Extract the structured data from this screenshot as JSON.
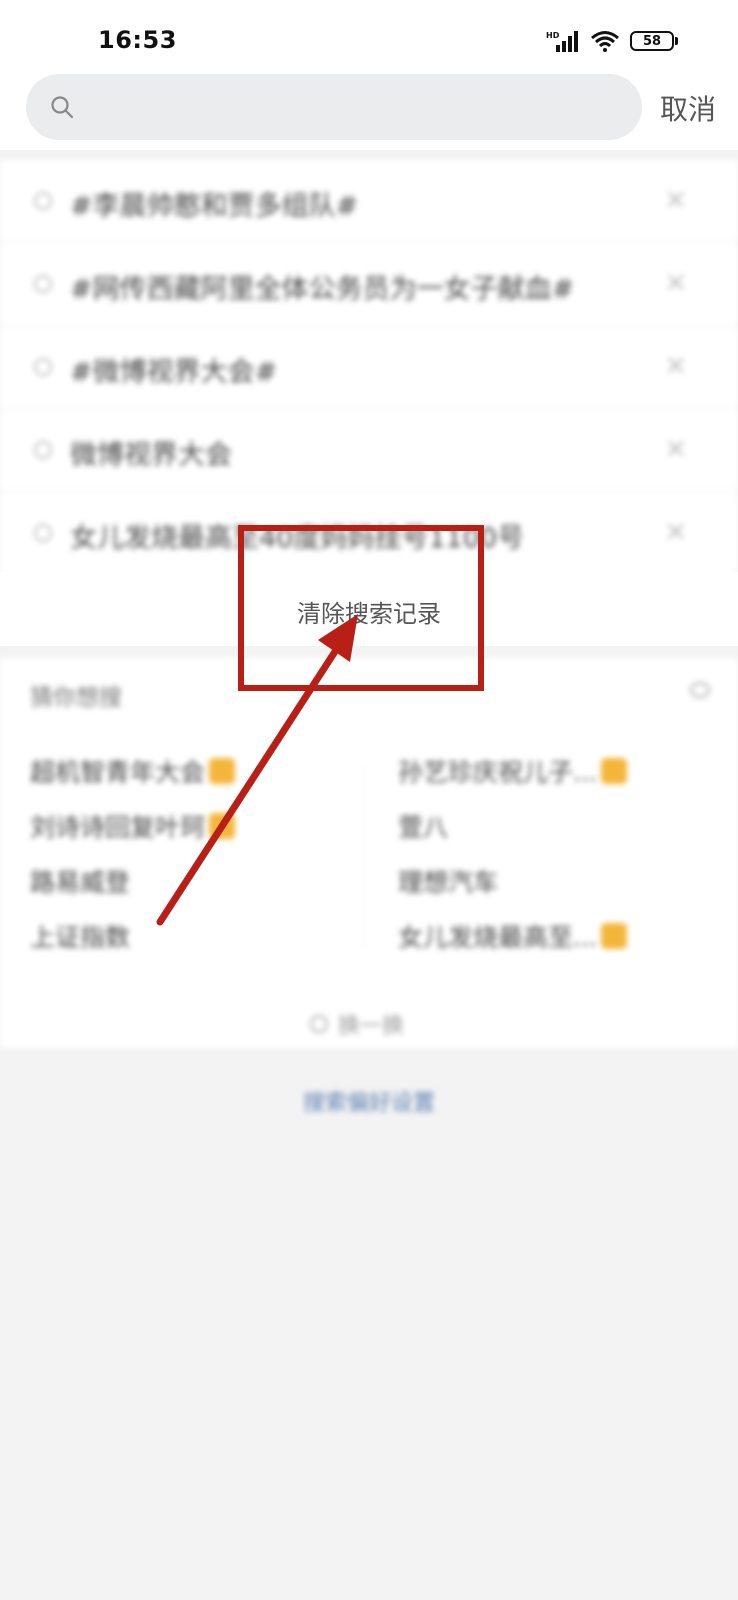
{
  "status_bar": {
    "time": "16:53",
    "battery_level": "58",
    "network_label": "HD"
  },
  "search": {
    "placeholder": "",
    "cancel_label": "取消"
  },
  "history": {
    "items": [
      {
        "text": "#李晨帅憨和贾多组队#"
      },
      {
        "text": "#网传西藏阿里全体公务员为一女子献血#"
      },
      {
        "text": "#微博视界大会#"
      },
      {
        "text": "微博视界大会"
      },
      {
        "text": "女儿发烧最高至40度妈妈挂号1100号"
      }
    ],
    "delete_symbol": "×",
    "clear_label": "清除搜索记录"
  },
  "guess": {
    "title": "猜你想搜",
    "left_items": [
      {
        "text": "超机智青年大会",
        "hot": true
      },
      {
        "text": "刘诗诗回复叶珂",
        "hot": true
      },
      {
        "text": "路易威登",
        "hot": false
      },
      {
        "text": "上证指数",
        "hot": false
      }
    ],
    "right_items": [
      {
        "text": "孙艺珍庆祝儿子...",
        "hot": true
      },
      {
        "text": "萱八",
        "hot": false
      },
      {
        "text": "理想汽车",
        "hot": false
      },
      {
        "text": "女儿发烧最高至...",
        "hot": true
      }
    ],
    "refresh_label": "换一换"
  },
  "footer": {
    "settings_label": "搜索偏好设置"
  },
  "annotation": {
    "color": "#b71f17"
  }
}
